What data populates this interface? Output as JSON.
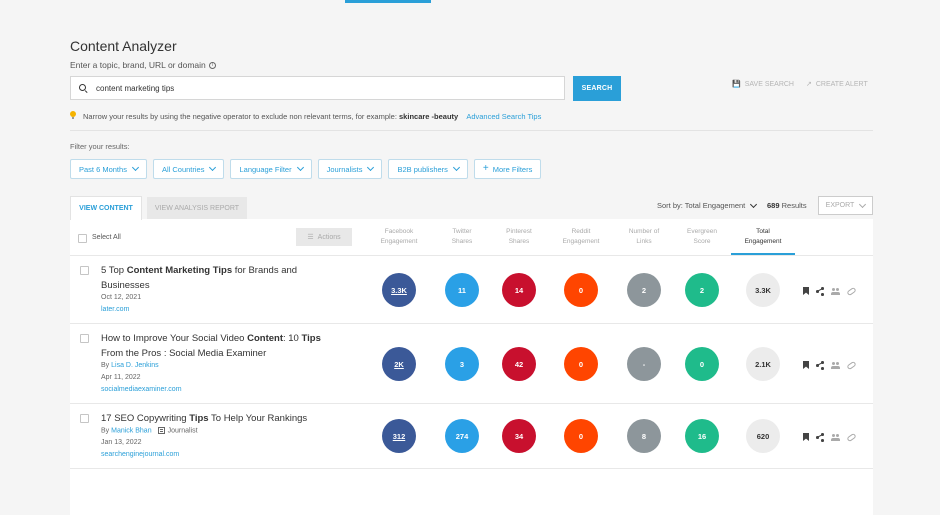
{
  "header": {
    "title": "Content Analyzer",
    "subtitle": "Enter a topic, brand, URL or domain"
  },
  "search": {
    "value": "content marketing tips",
    "button": "SEARCH",
    "save_search": "SAVE SEARCH",
    "create_alert": "CREATE ALERT"
  },
  "tip": {
    "text": "Narrow your results by using the negative operator to exclude non relevant terms, for example:",
    "example": "skincare -beauty",
    "link": "Advanced Search Tips"
  },
  "filters": {
    "label": "Filter your results:",
    "items": [
      "Past 6 Months",
      "All Countries",
      "Language Filter",
      "Journalists",
      "B2B publishers"
    ],
    "more": "More Filters"
  },
  "tabs": {
    "active": "VIEW CONTENT",
    "inactive": "VIEW ANALYSIS REPORT"
  },
  "sort": {
    "label": "Sort by: Total Engagement",
    "count": "689",
    "results_word": "Results",
    "export": "EXPORT"
  },
  "table": {
    "select_all": "Select All",
    "actions": "Actions",
    "columns": [
      {
        "line1": "Facebook",
        "line2": "Engagement"
      },
      {
        "line1": "Twitter",
        "line2": "Shares"
      },
      {
        "line1": "Pinterest",
        "line2": "Shares"
      },
      {
        "line1": "Reddit",
        "line2": "Engagement"
      },
      {
        "line1": "Number of",
        "line2": "Links"
      },
      {
        "line1": "Evergreen",
        "line2": "Score"
      },
      {
        "line1": "Total",
        "line2": "Engagement"
      }
    ],
    "rows": [
      {
        "title_pre": "5 Top ",
        "title_bold": "Content Marketing Tips",
        "title_post": " for Brands and Businesses",
        "date": "Oct 12, 2021",
        "domain": "later.com",
        "facebook": "3.3K",
        "twitter": "11",
        "pinterest": "14",
        "reddit": "0",
        "links": "2",
        "evergreen": "2",
        "total": "3.3K"
      },
      {
        "title_pre": "How to Improve Your Social Video ",
        "title_bold": "Content",
        "title_mid": ": 10 ",
        "title_bold2": "Tips",
        "title_post": " From the Pros : Social Media Examiner",
        "by": "By",
        "author": "Lisa D. Jenkins",
        "date": "Apr 11, 2022",
        "domain": "socialmediaexaminer.com",
        "facebook": "2K",
        "twitter": "3",
        "pinterest": "42",
        "reddit": "0",
        "links": "-",
        "evergreen": "0",
        "total": "2.1K"
      },
      {
        "title_pre": "17 SEO Copywriting ",
        "title_bold": "Tips",
        "title_post": " To Help Your Rankings",
        "by": "By",
        "author": "Manick Bhan",
        "badge": "Journalist",
        "date": "Jan 13, 2022",
        "domain": "searchenginejournal.com",
        "facebook": "312",
        "twitter": "274",
        "pinterest": "34",
        "reddit": "0",
        "links": "8",
        "evergreen": "16",
        "total": "620"
      }
    ]
  }
}
